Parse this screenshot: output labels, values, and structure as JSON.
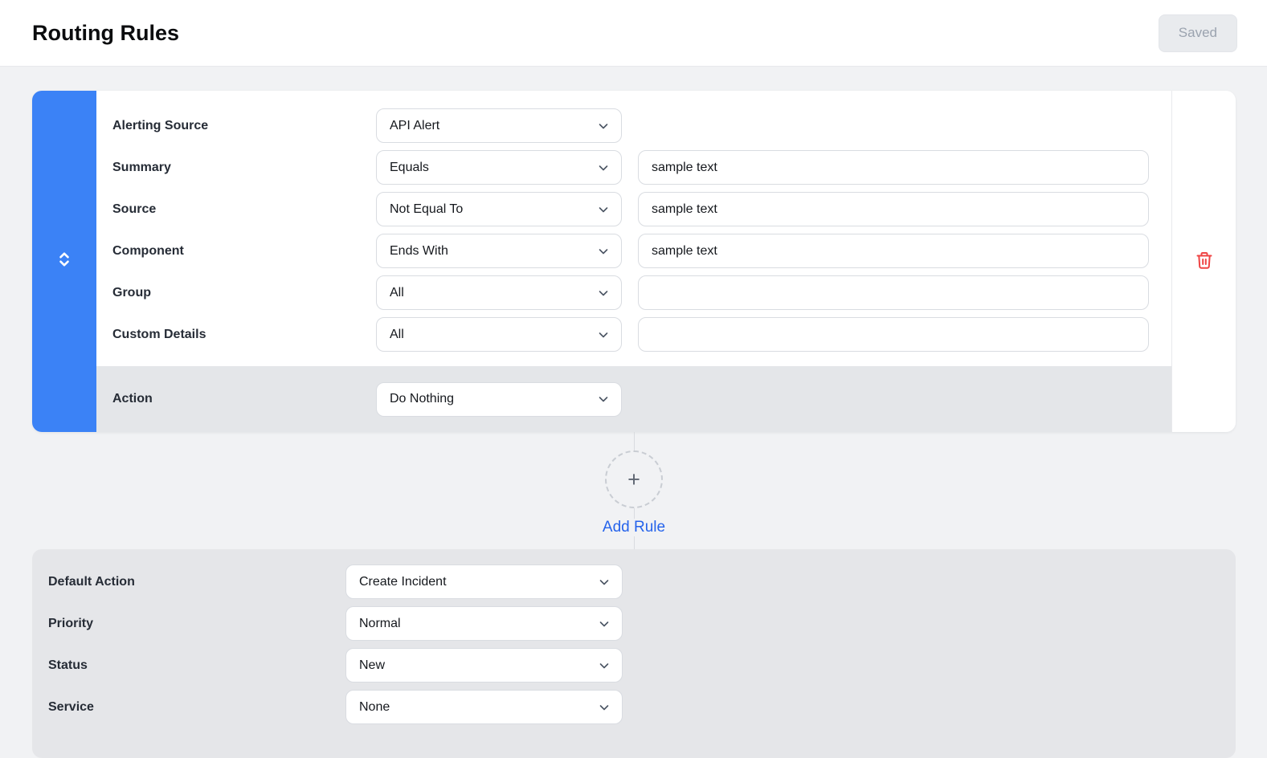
{
  "header": {
    "title": "Routing Rules",
    "saved_label": "Saved"
  },
  "rule_card": {
    "conditions": [
      {
        "label": "Alerting Source",
        "operator": "API Alert",
        "has_input": false,
        "value": ""
      },
      {
        "label": "Summary",
        "operator": "Equals",
        "has_input": true,
        "value": "sample text"
      },
      {
        "label": "Source",
        "operator": "Not Equal To",
        "has_input": true,
        "value": "sample text"
      },
      {
        "label": "Component",
        "operator": "Ends With",
        "has_input": true,
        "value": "sample text"
      },
      {
        "label": "Group",
        "operator": "All",
        "has_input": true,
        "value": ""
      },
      {
        "label": "Custom Details",
        "operator": "All",
        "has_input": true,
        "value": ""
      }
    ],
    "action": {
      "label": "Action",
      "value": "Do Nothing"
    }
  },
  "add_rule": {
    "label": "Add Rule",
    "plus_glyph": "+"
  },
  "defaults": {
    "rows": [
      {
        "label": "Default Action",
        "value": "Create Incident"
      },
      {
        "label": "Priority",
        "value": "Normal"
      },
      {
        "label": "Status",
        "value": "New"
      },
      {
        "label": "Service",
        "value": "None"
      }
    ]
  },
  "icons": {
    "drag_handle": "chevrons-up-down",
    "select_caret": "chevron-down",
    "delete": "trash",
    "add": "plus"
  },
  "colors": {
    "accent_blue": "#3b82f6",
    "link_blue": "#2563eb",
    "delete_red": "#ef4444",
    "page_bg": "#f1f2f4",
    "band_gray": "#e4e6e9",
    "panel_gray": "#e5e6e9",
    "border_gray": "#d9dce1",
    "saved_text": "#9ba3af"
  }
}
